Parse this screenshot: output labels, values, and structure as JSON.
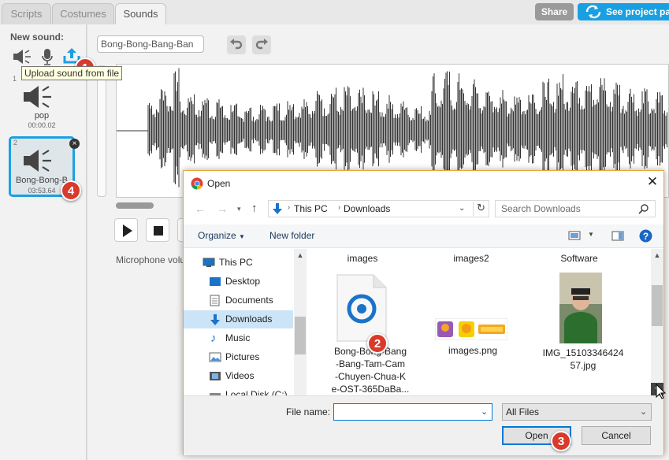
{
  "tabs": [
    {
      "label": "Scripts",
      "active": false
    },
    {
      "label": "Costumes",
      "active": false
    },
    {
      "label": "Sounds",
      "active": true
    }
  ],
  "topbar": {
    "share_label": "Share",
    "project_page_label": "See project pa"
  },
  "left": {
    "new_sound_label": "New sound:",
    "tooltip": "Upload sound from file",
    "sounds": [
      {
        "index": "1",
        "name": "pop",
        "duration": "00:00.02"
      },
      {
        "index": "2",
        "name": "Bong-Bong-B",
        "duration": "03:53.64"
      }
    ]
  },
  "editor": {
    "sound_name": "Bong-Bong-Bang-Ban",
    "mic_label": "Microphone volu"
  },
  "badges": [
    "1",
    "2",
    "3",
    "4"
  ],
  "dialog": {
    "title": "Open",
    "path": [
      "This PC",
      "Downloads"
    ],
    "search_placeholder": "Search Downloads",
    "organize_label": "Organize",
    "new_folder_label": "New folder",
    "nav": [
      "This PC",
      "Desktop",
      "Documents",
      "Downloads",
      "Music",
      "Pictures",
      "Videos",
      "Local Disk (C:)"
    ],
    "folders": [
      "images",
      "images2",
      "Software"
    ],
    "files": [
      {
        "name_lines": [
          "Bong-Bong-Bang",
          "-Bang-Tam-Cam",
          "-Chuyen-Chua-K",
          "e-OST-365DaBa..."
        ]
      },
      {
        "name_lines": [
          "images.png"
        ]
      },
      {
        "name_lines": [
          "IMG_15103346424",
          "57.jpg"
        ]
      }
    ],
    "filename_label": "File name:",
    "filename_value": "",
    "filetype": "All Files",
    "open_label": "Open",
    "cancel_label": "Cancel"
  },
  "colors": {
    "accent": "#1aa0e2",
    "share": "#9a9a9a",
    "badge": "#d93a2b",
    "selection": "#cce4f7"
  }
}
